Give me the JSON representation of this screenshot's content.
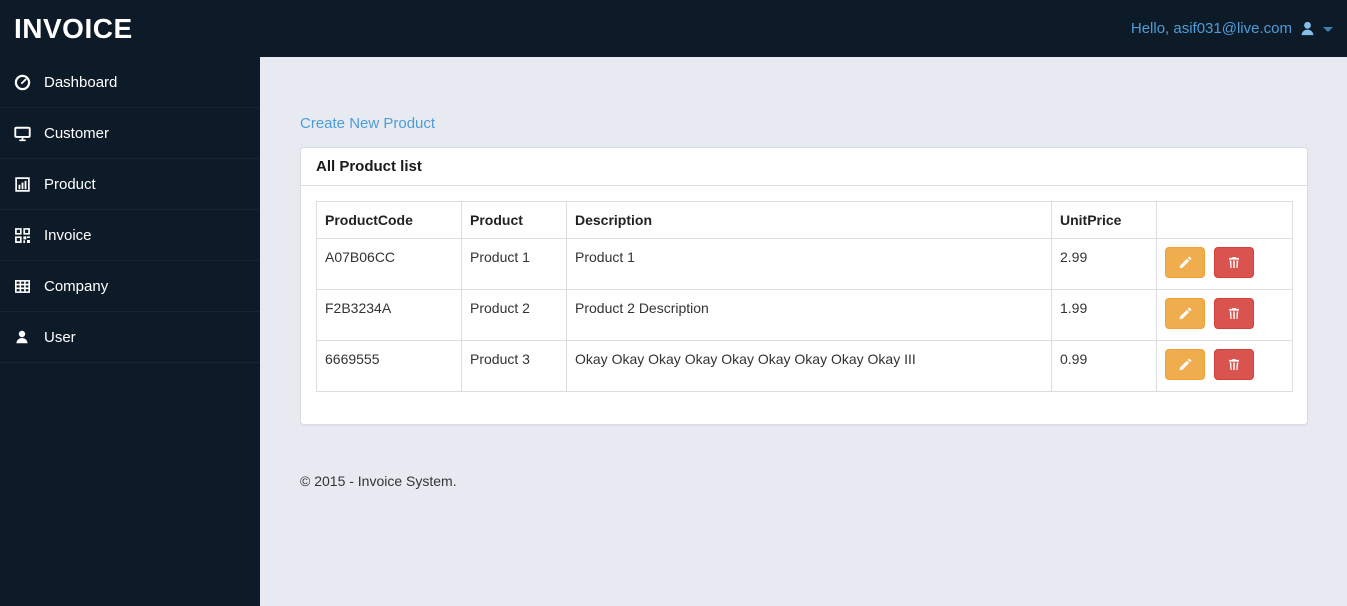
{
  "header": {
    "brand": "INVOICE",
    "user_greeting": "Hello, asif031@live.com"
  },
  "sidebar": {
    "items": [
      {
        "label": "Dashboard",
        "icon": "dashboard-gauge-icon"
      },
      {
        "label": "Customer",
        "icon": "desktop-icon"
      },
      {
        "label": "Product",
        "icon": "bar-chart-icon"
      },
      {
        "label": "Invoice",
        "icon": "qrcode-icon"
      },
      {
        "label": "Company",
        "icon": "table-grid-icon"
      },
      {
        "label": "User",
        "icon": "person-icon"
      }
    ]
  },
  "main": {
    "create_link": "Create New Product",
    "panel_title": "All Product list",
    "table": {
      "columns": [
        "ProductCode",
        "Product",
        "Description",
        "UnitPrice",
        ""
      ],
      "rows": [
        {
          "code": "A07B06CC",
          "product": "Product 1",
          "description": "Product 1",
          "unit_price": "2.99"
        },
        {
          "code": "F2B3234A",
          "product": "Product 2",
          "description": "Product 2 Description",
          "unit_price": "1.99"
        },
        {
          "code": "6669555",
          "product": "Product 3",
          "description": "Okay Okay Okay Okay Okay Okay Okay Okay Okay III",
          "unit_price": "0.99"
        }
      ]
    },
    "footer": "© 2015 - Invoice System."
  },
  "colors": {
    "navbar": "#0d1b28",
    "accent_blue": "#4e9cd8",
    "edit_button": "#f0ad4e",
    "delete_button": "#d9534f",
    "background": "#e7ebf1"
  }
}
